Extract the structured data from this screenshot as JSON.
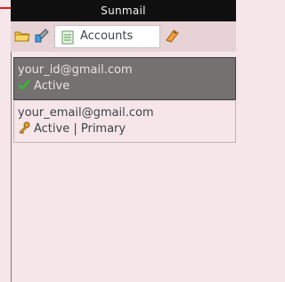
{
  "window": {
    "title": "Sunmail"
  },
  "tabs": {
    "folder_icon": "folder-icon",
    "settings_icon": "wrench-icon",
    "active": {
      "icon": "document-icon",
      "label": "Accounts"
    },
    "tag_icon": "tag-icon"
  },
  "accounts": [
    {
      "email": "your_id@gmail.com",
      "status": "Active",
      "status_icon": "checkmark-icon",
      "selected": true
    },
    {
      "email": "your_email@gmail.com",
      "status": "Active | Primary",
      "status_icon": "key-icon",
      "selected": false
    }
  ],
  "colors": {
    "accent": "#e2171b",
    "titlebar": "#0f0f0f",
    "background": "#f6e6e9",
    "selected_row": "#757171"
  }
}
